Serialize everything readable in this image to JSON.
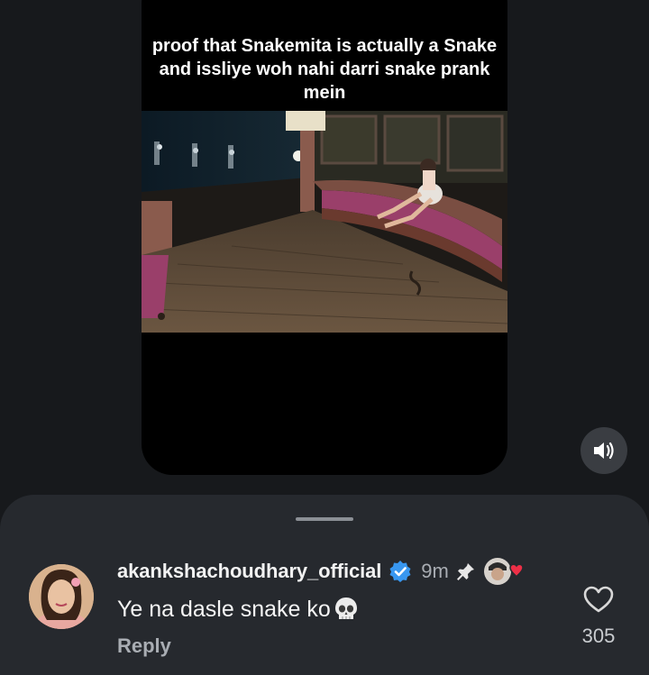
{
  "post": {
    "caption": "proof that Snakemita is actually a Snake and issliye woh nahi darri snake prank mein"
  },
  "comment": {
    "username": "akankshachoudhary_official",
    "time": "9m",
    "text": "Ye na dasle snake ko",
    "text_emoji": "skull",
    "reply_label": "Reply",
    "like_count": "305",
    "verified": true,
    "pinned": true,
    "liked_by_creator": true
  },
  "colors": {
    "background": "#17191c",
    "sheet": "#26292e",
    "verified_badge": "#3897f0",
    "heart_red": "#ed2f47"
  }
}
